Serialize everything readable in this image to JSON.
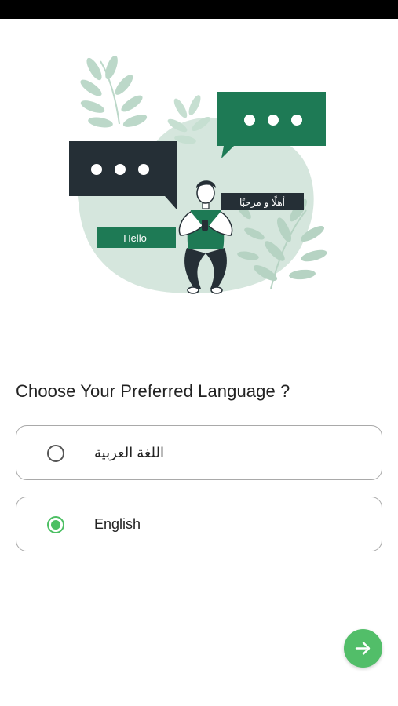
{
  "illustration": {
    "bubble_hello": "Hello",
    "bubble_arabic": "أهلًا و مرحبًا"
  },
  "question": "Choose Your Preferred Language ?",
  "options": [
    {
      "label": "اللغة العربية",
      "selected": false
    },
    {
      "label": "English",
      "selected": true
    }
  ],
  "next_icon": "arrow-right-icon",
  "colors": {
    "accent": "#52be69",
    "dark_green": "#1e7a55",
    "dark_bubble": "#252f36",
    "blob": "#d5e6dd"
  }
}
